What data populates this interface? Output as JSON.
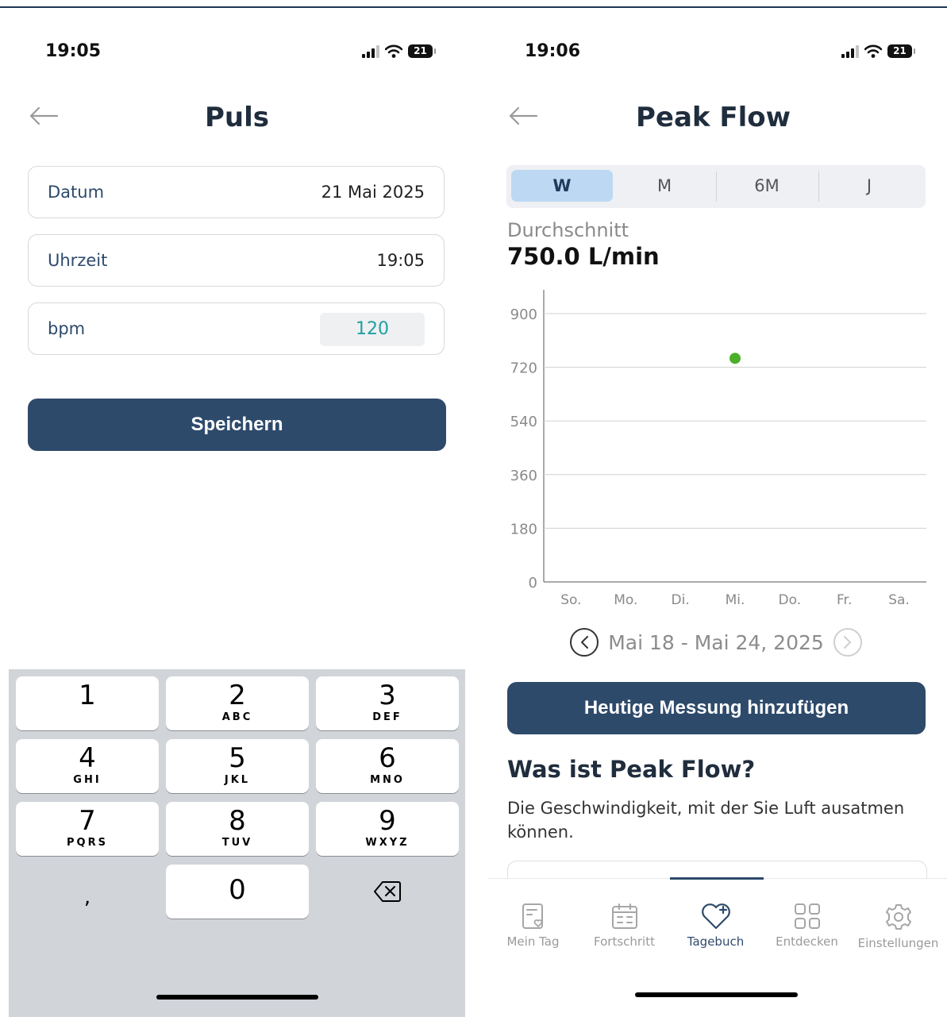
{
  "left_screen": {
    "status": {
      "time": "19:05",
      "battery": "21"
    },
    "title": "Puls",
    "fields": [
      {
        "label": "Datum",
        "value": "21 Mai 2025"
      },
      {
        "label": "Uhrzeit",
        "value": "19:05"
      },
      {
        "label": "bpm",
        "value": "120"
      }
    ],
    "save_label": "Speichern",
    "keypad": [
      {
        "num": "1",
        "letters": ""
      },
      {
        "num": "2",
        "letters": "ABC"
      },
      {
        "num": "3",
        "letters": "DEF"
      },
      {
        "num": "4",
        "letters": "GHI"
      },
      {
        "num": "5",
        "letters": "JKL"
      },
      {
        "num": "6",
        "letters": "MNO"
      },
      {
        "num": "7",
        "letters": "PQRS"
      },
      {
        "num": "8",
        "letters": "TUV"
      },
      {
        "num": "9",
        "letters": "WXYZ"
      },
      {
        "num": ",",
        "letters": ""
      },
      {
        "num": "0",
        "letters": ""
      }
    ]
  },
  "right_screen": {
    "status": {
      "time": "19:06",
      "battery": "21"
    },
    "title": "Peak Flow",
    "segments": [
      "W",
      "M",
      "6M",
      "J"
    ],
    "selected_segment": "W",
    "average_label": "Durchschnitt",
    "average_value": "750.0 L/min",
    "date_range": "Mai 18 - Mai 24, 2025",
    "add_button_label": "Heutige Messung hinzufügen",
    "info_title": "Was ist Peak Flow?",
    "info_text": "Die Geschwindigkeit, mit der Sie Luft ausatmen können.",
    "tabs": [
      {
        "label": "Mein Tag",
        "icon": "my-day-icon"
      },
      {
        "label": "Fortschritt",
        "icon": "calendar-icon"
      },
      {
        "label": "Tagebuch",
        "icon": "heart-plus-icon"
      },
      {
        "label": "Entdecken",
        "icon": "grid-icon"
      },
      {
        "label": "Einstellungen",
        "icon": "gear-icon"
      }
    ],
    "active_tab": "Tagebuch",
    "colors": {
      "primary": "#2e4a6b",
      "point": "#4caf2a",
      "segment_active": "#bcd8f3",
      "bpm_value": "#20a0a0"
    }
  },
  "chart_data": {
    "type": "scatter",
    "title": "",
    "xlabel": "",
    "ylabel": "",
    "categories": [
      "So.",
      "Mo.",
      "Di.",
      "Mi.",
      "Do.",
      "Fr.",
      "Sa."
    ],
    "yticks": [
      0,
      180,
      360,
      540,
      720,
      900
    ],
    "ylim": [
      0,
      900
    ],
    "grid": true,
    "points": [
      {
        "x": "Mi.",
        "y": 750
      }
    ]
  }
}
